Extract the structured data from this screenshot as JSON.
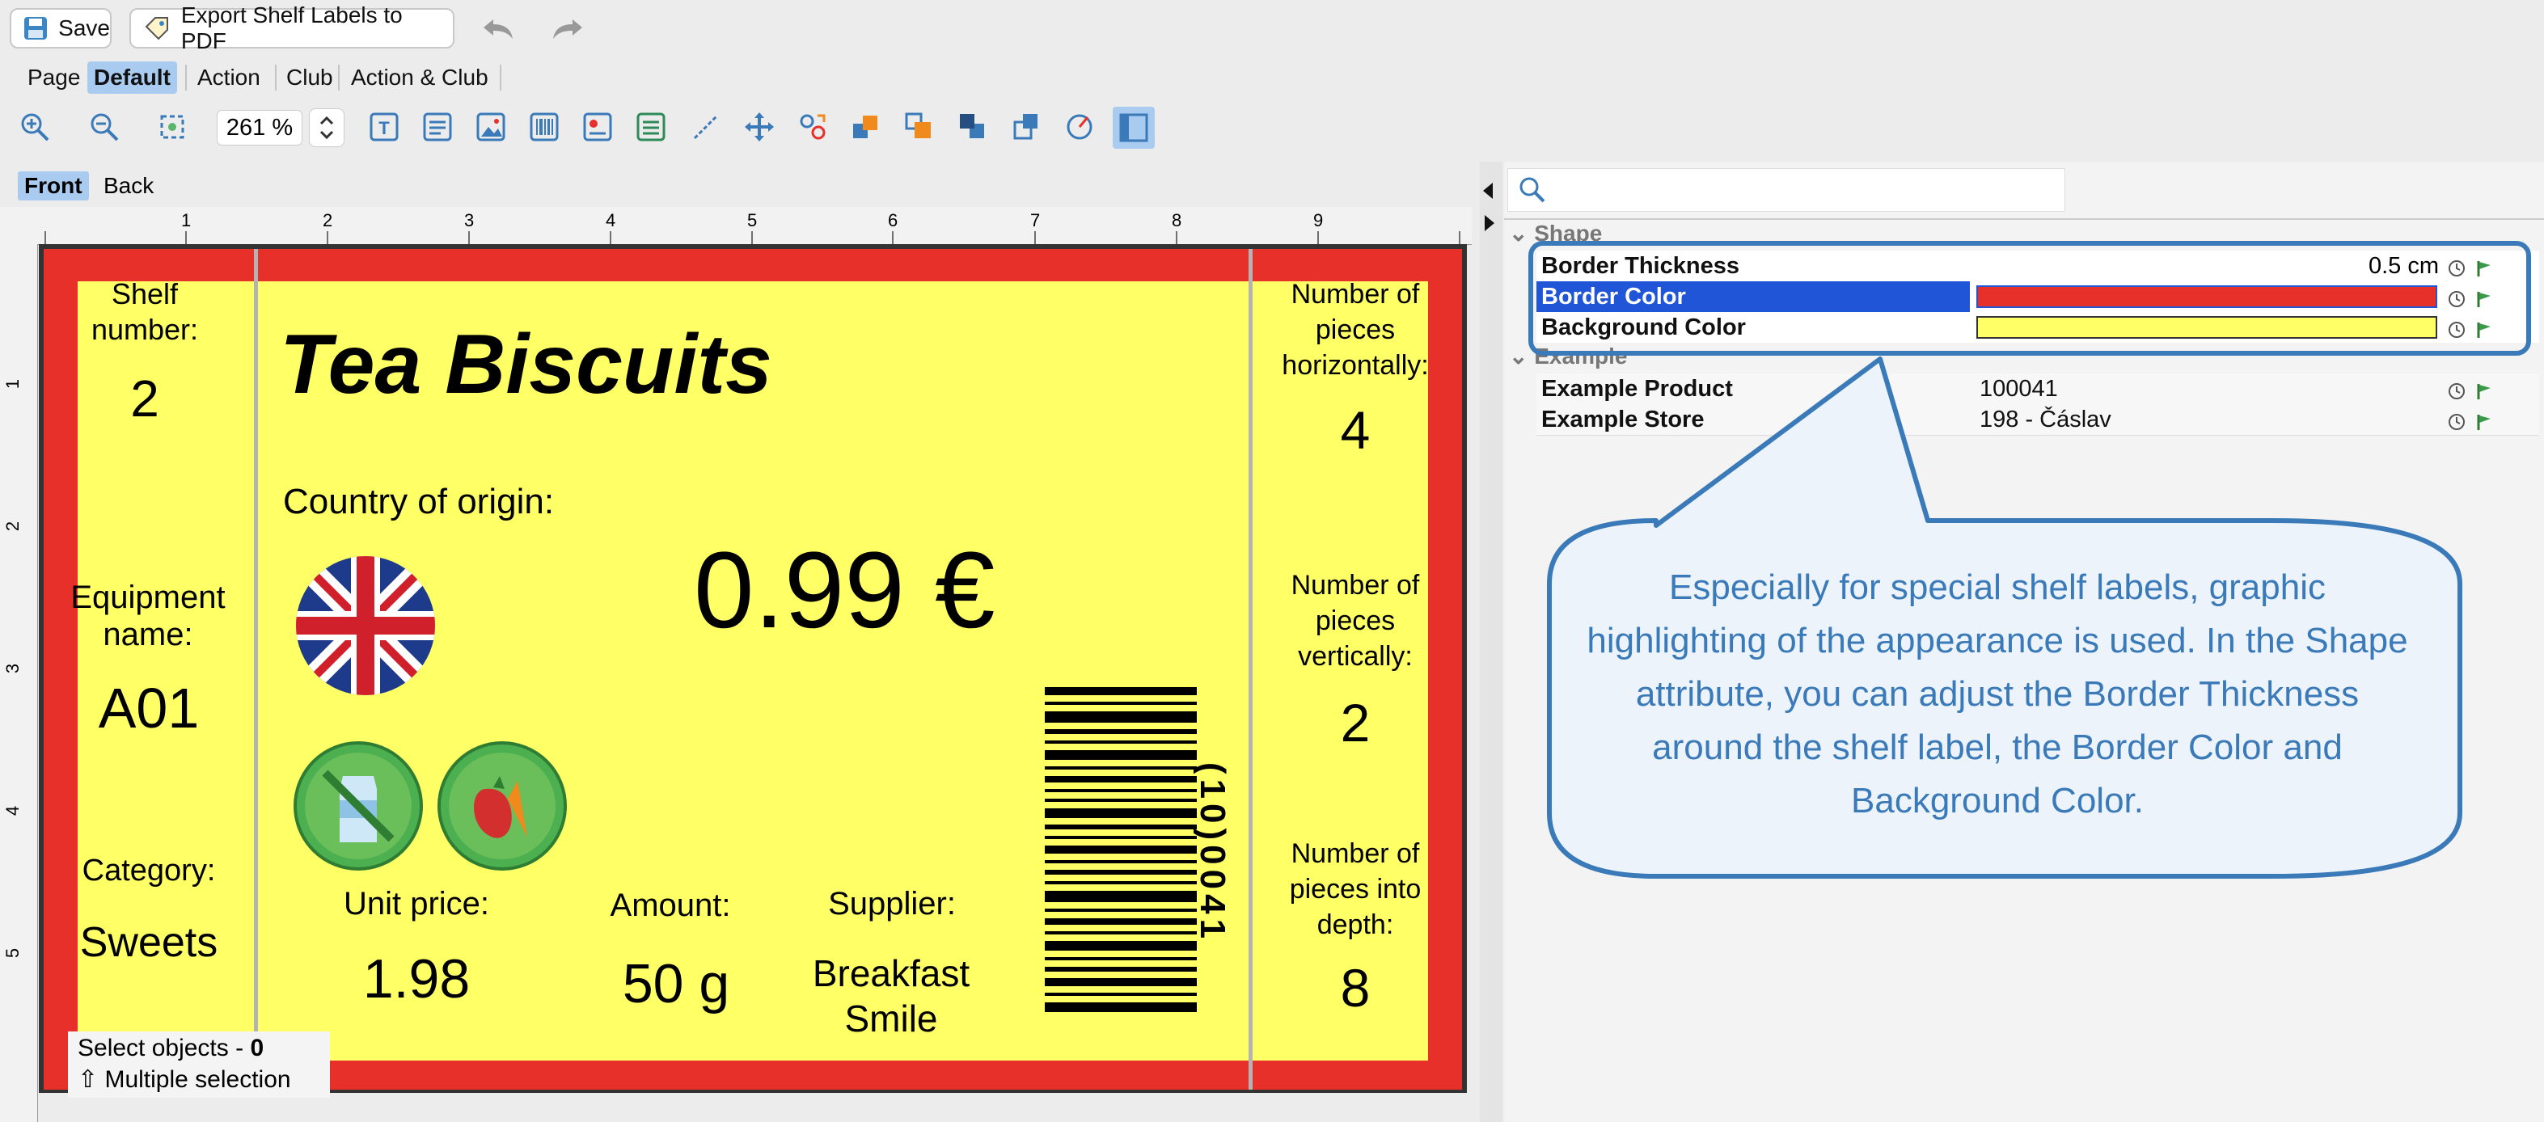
{
  "toolbar": {
    "save_label": "Save",
    "export_label": "Export Shelf Labels to PDF",
    "zoom_value": "261 %"
  },
  "view_tabs": [
    "Page",
    "Default",
    "Action",
    "Club",
    "Action & Club"
  ],
  "side_tabs": [
    "Front",
    "Back"
  ],
  "ruler": {
    "h_ticks": [
      "1",
      "2",
      "3",
      "4",
      "5",
      "6",
      "7",
      "8",
      "9"
    ],
    "v_ticks": [
      "1",
      "2",
      "3",
      "4",
      "5"
    ]
  },
  "label": {
    "shelf_number_title": "Shelf number:",
    "shelf_number": "2",
    "equipment_title": "Equipment name:",
    "equipment_value": "A01",
    "category_title": "Category:",
    "category_value": "Sweets",
    "product_name": "Tea Biscuits",
    "origin_title": "Country of origin:",
    "price": "0.99 €",
    "unit_price_title": "Unit price:",
    "unit_price": "1.98",
    "amount_title": "Amount:",
    "amount": "50 g",
    "supplier_title": "Supplier:",
    "supplier": "Breakfast Smile",
    "barcode_text": "(10)0041",
    "horiz_title": "Number of pieces horizontally:",
    "horiz_value": "4",
    "vert_title": "Number of pieces vertically:",
    "vert_value": "2",
    "depth_title": "Number of pieces into depth:",
    "depth_value": "8",
    "border_color": "#e8302a",
    "background_color": "#ffff66"
  },
  "status": {
    "select_label": "Select objects -",
    "select_count": "0",
    "multiple": "⇧ Multiple selection"
  },
  "properties": {
    "search_placeholder": "",
    "group_shape": "Shape",
    "group_example": "Example",
    "rows": [
      {
        "key": "Border Thickness",
        "value": "0.5 cm"
      },
      {
        "key": "Border Color",
        "value": ""
      },
      {
        "key": "Background Color",
        "value": ""
      },
      {
        "key": "Example Product",
        "value": "100041"
      },
      {
        "key": "Example Store",
        "value": "198 - Čáslav"
      }
    ]
  },
  "callout": "Especially for special shelf labels, graphic highlighting of the appearance is used. In the Shape attribute, you can adjust the Border Thickness around the shelf label, the Border Color and Background Color.",
  "colors": {
    "accent_blue": "#3a7ab9",
    "selected_row": "#1f55d6",
    "callout_text": "#3a7ab9"
  }
}
